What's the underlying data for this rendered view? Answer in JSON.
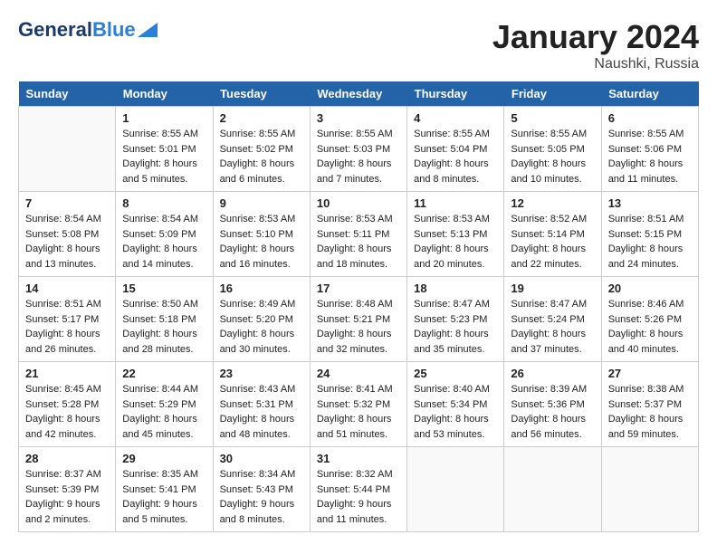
{
  "header": {
    "logo_general": "General",
    "logo_blue": "Blue",
    "month": "January 2024",
    "location": "Naushki, Russia"
  },
  "days_of_week": [
    "Sunday",
    "Monday",
    "Tuesday",
    "Wednesday",
    "Thursday",
    "Friday",
    "Saturday"
  ],
  "weeks": [
    [
      {
        "day": "",
        "sunrise": "",
        "sunset": "",
        "daylight": "",
        "empty": true
      },
      {
        "day": "1",
        "sunrise": "Sunrise: 8:55 AM",
        "sunset": "Sunset: 5:01 PM",
        "daylight": "Daylight: 8 hours and 5 minutes."
      },
      {
        "day": "2",
        "sunrise": "Sunrise: 8:55 AM",
        "sunset": "Sunset: 5:02 PM",
        "daylight": "Daylight: 8 hours and 6 minutes."
      },
      {
        "day": "3",
        "sunrise": "Sunrise: 8:55 AM",
        "sunset": "Sunset: 5:03 PM",
        "daylight": "Daylight: 8 hours and 7 minutes."
      },
      {
        "day": "4",
        "sunrise": "Sunrise: 8:55 AM",
        "sunset": "Sunset: 5:04 PM",
        "daylight": "Daylight: 8 hours and 8 minutes."
      },
      {
        "day": "5",
        "sunrise": "Sunrise: 8:55 AM",
        "sunset": "Sunset: 5:05 PM",
        "daylight": "Daylight: 8 hours and 10 minutes."
      },
      {
        "day": "6",
        "sunrise": "Sunrise: 8:55 AM",
        "sunset": "Sunset: 5:06 PM",
        "daylight": "Daylight: 8 hours and 11 minutes."
      }
    ],
    [
      {
        "day": "7",
        "sunrise": "Sunrise: 8:54 AM",
        "sunset": "Sunset: 5:08 PM",
        "daylight": "Daylight: 8 hours and 13 minutes."
      },
      {
        "day": "8",
        "sunrise": "Sunrise: 8:54 AM",
        "sunset": "Sunset: 5:09 PM",
        "daylight": "Daylight: 8 hours and 14 minutes."
      },
      {
        "day": "9",
        "sunrise": "Sunrise: 8:53 AM",
        "sunset": "Sunset: 5:10 PM",
        "daylight": "Daylight: 8 hours and 16 minutes."
      },
      {
        "day": "10",
        "sunrise": "Sunrise: 8:53 AM",
        "sunset": "Sunset: 5:11 PM",
        "daylight": "Daylight: 8 hours and 18 minutes."
      },
      {
        "day": "11",
        "sunrise": "Sunrise: 8:53 AM",
        "sunset": "Sunset: 5:13 PM",
        "daylight": "Daylight: 8 hours and 20 minutes."
      },
      {
        "day": "12",
        "sunrise": "Sunrise: 8:52 AM",
        "sunset": "Sunset: 5:14 PM",
        "daylight": "Daylight: 8 hours and 22 minutes."
      },
      {
        "day": "13",
        "sunrise": "Sunrise: 8:51 AM",
        "sunset": "Sunset: 5:15 PM",
        "daylight": "Daylight: 8 hours and 24 minutes."
      }
    ],
    [
      {
        "day": "14",
        "sunrise": "Sunrise: 8:51 AM",
        "sunset": "Sunset: 5:17 PM",
        "daylight": "Daylight: 8 hours and 26 minutes."
      },
      {
        "day": "15",
        "sunrise": "Sunrise: 8:50 AM",
        "sunset": "Sunset: 5:18 PM",
        "daylight": "Daylight: 8 hours and 28 minutes."
      },
      {
        "day": "16",
        "sunrise": "Sunrise: 8:49 AM",
        "sunset": "Sunset: 5:20 PM",
        "daylight": "Daylight: 8 hours and 30 minutes."
      },
      {
        "day": "17",
        "sunrise": "Sunrise: 8:48 AM",
        "sunset": "Sunset: 5:21 PM",
        "daylight": "Daylight: 8 hours and 32 minutes."
      },
      {
        "day": "18",
        "sunrise": "Sunrise: 8:47 AM",
        "sunset": "Sunset: 5:23 PM",
        "daylight": "Daylight: 8 hours and 35 minutes."
      },
      {
        "day": "19",
        "sunrise": "Sunrise: 8:47 AM",
        "sunset": "Sunset: 5:24 PM",
        "daylight": "Daylight: 8 hours and 37 minutes."
      },
      {
        "day": "20",
        "sunrise": "Sunrise: 8:46 AM",
        "sunset": "Sunset: 5:26 PM",
        "daylight": "Daylight: 8 hours and 40 minutes."
      }
    ],
    [
      {
        "day": "21",
        "sunrise": "Sunrise: 8:45 AM",
        "sunset": "Sunset: 5:28 PM",
        "daylight": "Daylight: 8 hours and 42 minutes."
      },
      {
        "day": "22",
        "sunrise": "Sunrise: 8:44 AM",
        "sunset": "Sunset: 5:29 PM",
        "daylight": "Daylight: 8 hours and 45 minutes."
      },
      {
        "day": "23",
        "sunrise": "Sunrise: 8:43 AM",
        "sunset": "Sunset: 5:31 PM",
        "daylight": "Daylight: 8 hours and 48 minutes."
      },
      {
        "day": "24",
        "sunrise": "Sunrise: 8:41 AM",
        "sunset": "Sunset: 5:32 PM",
        "daylight": "Daylight: 8 hours and 51 minutes."
      },
      {
        "day": "25",
        "sunrise": "Sunrise: 8:40 AM",
        "sunset": "Sunset: 5:34 PM",
        "daylight": "Daylight: 8 hours and 53 minutes."
      },
      {
        "day": "26",
        "sunrise": "Sunrise: 8:39 AM",
        "sunset": "Sunset: 5:36 PM",
        "daylight": "Daylight: 8 hours and 56 minutes."
      },
      {
        "day": "27",
        "sunrise": "Sunrise: 8:38 AM",
        "sunset": "Sunset: 5:37 PM",
        "daylight": "Daylight: 8 hours and 59 minutes."
      }
    ],
    [
      {
        "day": "28",
        "sunrise": "Sunrise: 8:37 AM",
        "sunset": "Sunset: 5:39 PM",
        "daylight": "Daylight: 9 hours and 2 minutes."
      },
      {
        "day": "29",
        "sunrise": "Sunrise: 8:35 AM",
        "sunset": "Sunset: 5:41 PM",
        "daylight": "Daylight: 9 hours and 5 minutes."
      },
      {
        "day": "30",
        "sunrise": "Sunrise: 8:34 AM",
        "sunset": "Sunset: 5:43 PM",
        "daylight": "Daylight: 9 hours and 8 minutes."
      },
      {
        "day": "31",
        "sunrise": "Sunrise: 8:32 AM",
        "sunset": "Sunset: 5:44 PM",
        "daylight": "Daylight: 9 hours and 11 minutes."
      },
      {
        "day": "",
        "sunrise": "",
        "sunset": "",
        "daylight": "",
        "empty": true
      },
      {
        "day": "",
        "sunrise": "",
        "sunset": "",
        "daylight": "",
        "empty": true
      },
      {
        "day": "",
        "sunrise": "",
        "sunset": "",
        "daylight": "",
        "empty": true
      }
    ]
  ]
}
